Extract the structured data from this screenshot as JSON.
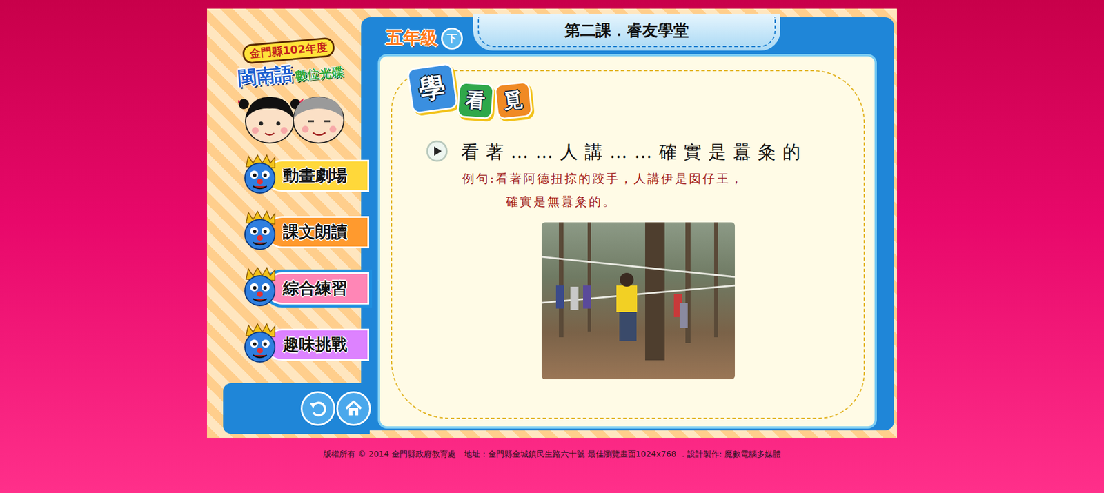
{
  "logo": {
    "year_line": "金門縣102年度",
    "language": "閩南語",
    "product": "數位光碟"
  },
  "grade": {
    "label": "五年級",
    "term": "下"
  },
  "lesson_title": "第二課．睿友學堂",
  "menu": [
    {
      "label": "動畫劇場",
      "color": "#ffd83a",
      "selected": false
    },
    {
      "label": "課文朗讀",
      "color": "#ff9a2e",
      "selected": false
    },
    {
      "label": "綜合練習",
      "color": "#ff86b6",
      "selected": true
    },
    {
      "label": "趣味挑戰",
      "color": "#dd82ff",
      "selected": false
    }
  ],
  "section_badge": [
    {
      "char": "學",
      "color": "#3a8fe0"
    },
    {
      "char": "看",
      "color": "#2fa84a"
    },
    {
      "char": "覓",
      "color": "#f08a24"
    }
  ],
  "phrase": "看著……人講……確實是囂粂的",
  "example": [
    "例句:看著阿德扭掠的跤手，人講伊是囡仔王，",
    "確實是無囂粂的。"
  ],
  "footer": "版權所有 © 2014 金門縣政府教育處　地址：金門縣金城鎮民生路六十號 最佳瀏覽畫面1024x768 ．設計製作: 魔數電腦多媒體"
}
